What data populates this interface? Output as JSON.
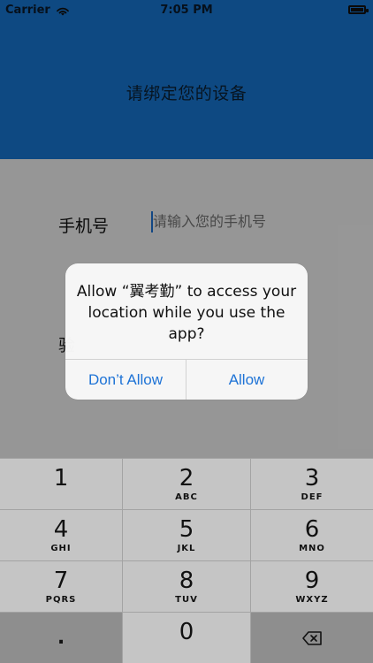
{
  "status_bar": {
    "carrier": "Carrier",
    "time": "7:05 PM"
  },
  "header": {
    "title": "请绑定您的设备"
  },
  "form": {
    "phone_label": "手机号",
    "phone_placeholder": "请输入您的手机号",
    "hidden_second_label": "验"
  },
  "alert": {
    "message": "Allow “翼考勤” to access your location while you use the app?",
    "dont_allow": "Don’t Allow",
    "allow": "Allow",
    "accent_color": "#1E73D6"
  },
  "keypad": {
    "keys": [
      {
        "num": "1",
        "letters": ""
      },
      {
        "num": "2",
        "letters": "ABC"
      },
      {
        "num": "3",
        "letters": "DEF"
      },
      {
        "num": "4",
        "letters": "GHI"
      },
      {
        "num": "5",
        "letters": "JKL"
      },
      {
        "num": "6",
        "letters": "MNO"
      },
      {
        "num": "7",
        "letters": "PQRS"
      },
      {
        "num": "8",
        "letters": "TUV"
      },
      {
        "num": "9",
        "letters": "WXYZ"
      },
      {
        "num": ".",
        "letters": ""
      },
      {
        "num": "0",
        "letters": ""
      },
      {
        "num": "",
        "letters": ""
      }
    ],
    "backspace_icon": "backspace-icon"
  },
  "colors": {
    "header_blue": "#1776D2",
    "page_background": "#F3F3F3",
    "keypad_background": "#A3A3A3",
    "key_light": "#C5C5C5",
    "key_dark": "#8E8E8E"
  }
}
